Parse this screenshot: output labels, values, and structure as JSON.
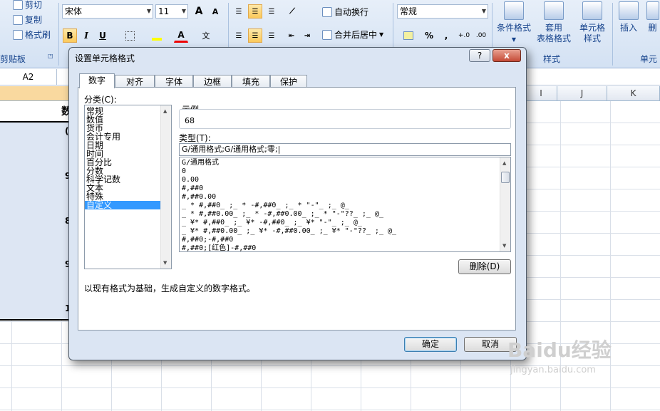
{
  "ribbon": {
    "clipboard": {
      "cut": "剪切",
      "copy": "复制",
      "format_painter": "格式刷",
      "group_label": "剪贴板"
    },
    "font": {
      "name": "宋体",
      "size": "11",
      "grow": "A",
      "shrink": "A",
      "bold": "B",
      "italic": "I",
      "underline": "U",
      "font_color_letter": "A",
      "phonetic": "文"
    },
    "alignment": {
      "wrap_text": "自动换行",
      "merge_center": "合并后居中"
    },
    "number": {
      "format": "常规",
      "percent": "%",
      "comma": ",",
      "inc_decimal": "+.0",
      "dec_decimal": ".00"
    },
    "styles": {
      "conditional": [
        "条件格式"
      ],
      "table_format": [
        "套用",
        "表格格式"
      ],
      "cell_styles": [
        "单元格",
        "样式"
      ],
      "group_label": "样式"
    },
    "cells": {
      "insert": "插入",
      "delete": "删",
      "group_label": "单元"
    }
  },
  "formula_bar": {
    "name_box": "A2"
  },
  "sheet": {
    "columns": [
      "I",
      "J",
      "K"
    ],
    "header_cell": "数",
    "left_marks": [
      "(",
      "9",
      "8",
      "9",
      "1"
    ]
  },
  "dialog": {
    "title": "设置单元格格式",
    "help": "?",
    "close": "x",
    "tabs": [
      "数字",
      "对齐",
      "字体",
      "边框",
      "填充",
      "保护"
    ],
    "selected_tab": 0,
    "category_label": "分类(C):",
    "categories": [
      "常规",
      "数值",
      "货币",
      "会计专用",
      "日期",
      "时间",
      "百分比",
      "分数",
      "科学记数",
      "文本",
      "特殊",
      "自定义"
    ],
    "selected_category": 11,
    "sample_label": "示例",
    "sample_value": "68",
    "type_label": "类型(T):",
    "type_value": "G/通用格式;G/通用格式;零;|",
    "formats": [
      "G/通用格式",
      "0",
      "0.00",
      "#,##0",
      "#,##0.00",
      "_ * #,##0_ ;_ * -#,##0_ ;_ * \"-\"_ ;_ @_",
      "_ * #,##0.00_ ;_ * -#,##0.00_ ;_ * \"-\"??_ ;_ @_",
      "_ ¥* #,##0_ ;_ ¥* -#,##0_ ;_ ¥* \"-\"_ ;_ @_",
      "_ ¥* #,##0.00_ ;_ ¥* -#,##0.00_ ;_ ¥* \"-\"??_ ;_ @_",
      "#,##0;-#,##0",
      "#,##0;[红色]-#,##0"
    ],
    "delete_button": "删除(D)",
    "description": "以现有格式为基础，生成自定义的数字格式。",
    "ok_button": "确定",
    "cancel_button": "取消"
  },
  "watermark": {
    "line1": "Baidu经验",
    "line2": "jingyan.baidu.com"
  }
}
